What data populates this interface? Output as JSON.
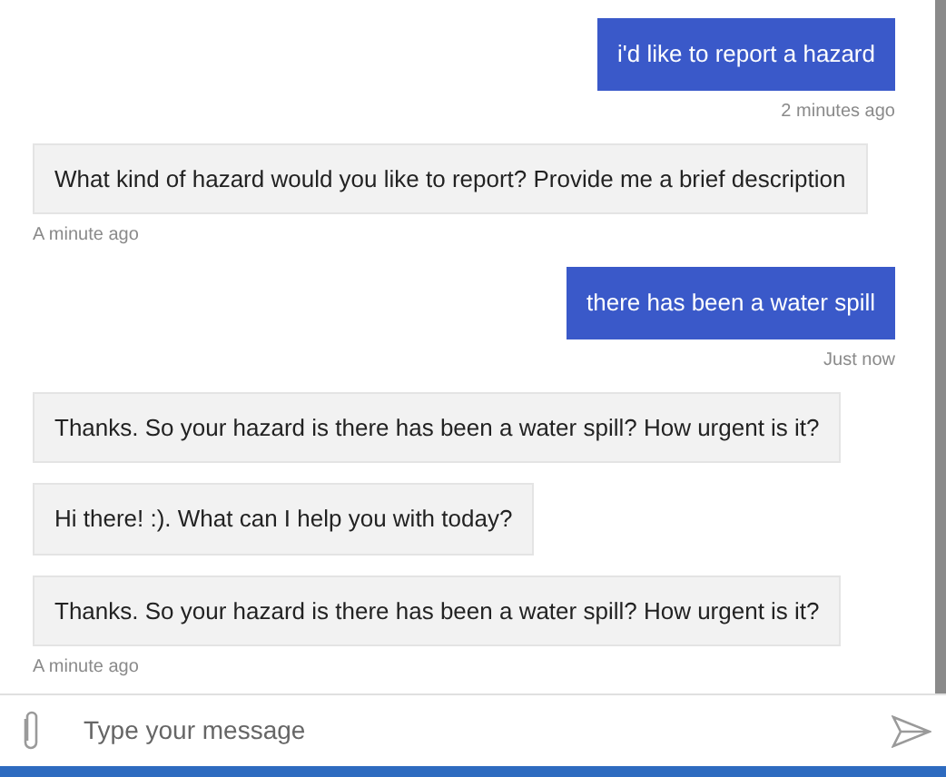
{
  "messages": [
    {
      "kind": "user",
      "text": "i'd like to report a hazard",
      "timestamp": "2 minutes ago"
    },
    {
      "kind": "bot",
      "text": "What kind of hazard would you like to report? Provide me a brief description",
      "timestamp": "A minute ago"
    },
    {
      "kind": "user",
      "text": "there has been a water spill",
      "timestamp": "Just now"
    },
    {
      "kind": "bot",
      "text": "Thanks. So your hazard is there has been a water spill? How urgent is it?"
    },
    {
      "kind": "bot",
      "text": "Hi there! :). What can I help you with today?"
    },
    {
      "kind": "bot",
      "text": "Thanks. So your hazard is there has been a water spill? How urgent is it?",
      "timestamp": "A minute ago"
    }
  ],
  "composer": {
    "placeholder": "Type your message"
  }
}
